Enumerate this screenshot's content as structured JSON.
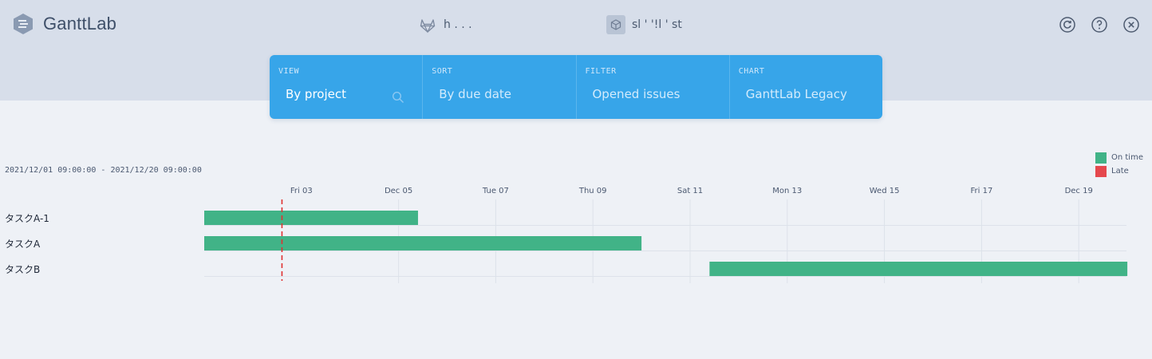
{
  "app": {
    "name": "GanttLab",
    "colors": {
      "header_bg": "#d7deea",
      "accent": "#37a5e9",
      "on_time": "#41b387",
      "late": "#e5484d",
      "today_line": "#e03131"
    }
  },
  "header": {
    "source_gitlab": {
      "icon": "gitlab-icon",
      "text": "h      .                     .  ."
    },
    "source_project": {
      "icon": "cube-icon",
      "text": "sl       '       '!l  '    st"
    },
    "actions": [
      {
        "name": "refresh",
        "icon": "refresh-icon"
      },
      {
        "name": "help",
        "icon": "help-icon"
      },
      {
        "name": "close",
        "icon": "close-icon"
      }
    ]
  },
  "controls": [
    {
      "label": "VIEW",
      "value": "By project",
      "active": true,
      "icon": "search-icon"
    },
    {
      "label": "SORT",
      "value": "By due date",
      "active": false
    },
    {
      "label": "FILTER",
      "value": "Opened issues",
      "active": false
    },
    {
      "label": "CHART",
      "value": "GanttLab Legacy",
      "active": false
    }
  ],
  "gantt": {
    "range_text": "2021/12/01 09:00:00 - 2021/12/20 09:00:00",
    "legend": [
      {
        "label": "On time",
        "color": "#41b387"
      },
      {
        "label": "Late",
        "color": "#e5484d"
      }
    ],
    "today_day": 2.6,
    "ticks": [
      {
        "day": 3,
        "label": "Fri 03"
      },
      {
        "day": 5,
        "label": "Dec 05"
      },
      {
        "day": 7,
        "label": "Tue 07"
      },
      {
        "day": 9,
        "label": "Thu 09"
      },
      {
        "day": 11,
        "label": "Sat 11"
      },
      {
        "day": 13,
        "label": "Mon 13"
      },
      {
        "day": 15,
        "label": "Wed 15"
      },
      {
        "day": 17,
        "label": "Fri 17"
      },
      {
        "day": 19,
        "label": "Dec 19"
      }
    ],
    "tasks": [
      {
        "name": "タスクA-1",
        "start_day": 1.0,
        "end_day": 5.4,
        "status": "on_time"
      },
      {
        "name": "タスクA",
        "start_day": 1.0,
        "end_day": 10.0,
        "status": "on_time"
      },
      {
        "name": "タスクB",
        "start_day": 11.4,
        "end_day": 20.0,
        "status": "on_time"
      }
    ]
  }
}
